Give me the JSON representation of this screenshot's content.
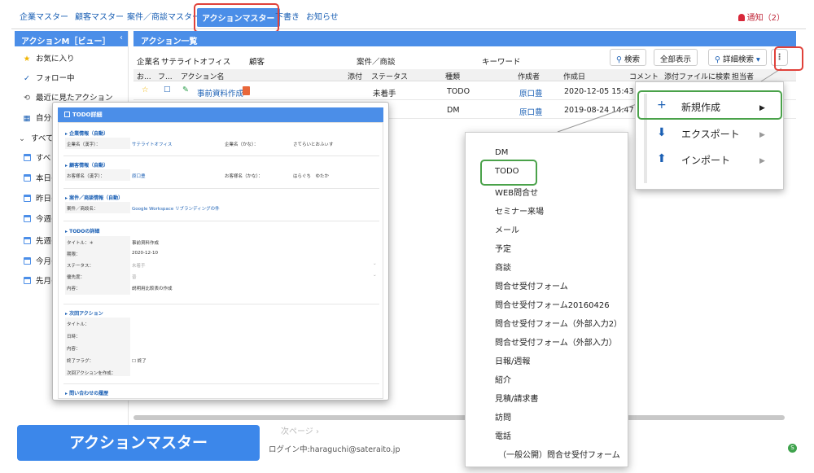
{
  "nav": {
    "tabs": [
      "企業マスター",
      "顧客マスター",
      "案件／商談マスター",
      "アクションマスター",
      "下書き",
      "お知らせ"
    ],
    "active_index": 3,
    "notice": "通知（2）"
  },
  "sidebar": {
    "title": "アクションM［ビュー］",
    "collapse": "‹",
    "items": [
      {
        "label": "お気に入り",
        "icon": "star-icon"
      },
      {
        "label": "フォロー中",
        "icon": "check-icon"
      },
      {
        "label": "最近に見たアクション",
        "icon": "history-icon"
      },
      {
        "label": "自分の",
        "icon": "grid-icon"
      },
      {
        "label": "すべての",
        "icon": "chevron-down-icon"
      },
      {
        "label": "すべ",
        "icon": "calendar-icon"
      },
      {
        "label": "本日の",
        "icon": "calendar-icon"
      },
      {
        "label": "昨日の",
        "icon": "calendar-icon"
      },
      {
        "label": "今週の",
        "icon": "calendar-icon"
      },
      {
        "label": "先週の",
        "icon": "calendar-icon"
      },
      {
        "label": "今月の",
        "icon": "calendar-icon"
      },
      {
        "label": "先月の",
        "icon": "calendar-icon"
      }
    ]
  },
  "main": {
    "title": "アクション一覧",
    "filters": {
      "company_label": "企業名",
      "company_value": "サテライトオフィス",
      "customer_label": "顧客",
      "deal_label": "案件／商談",
      "keyword_label": "キーワード"
    },
    "buttons": {
      "search": "検索",
      "show_all": "全部表示",
      "advanced": "詳細検索"
    },
    "columns": [
      "お...",
      "フ...",
      "アクション名",
      "添付",
      "ステータス",
      "種類",
      "作成者",
      "作成日",
      "コメント",
      "添付ファイルに検索",
      "担当者"
    ],
    "rows": [
      {
        "name": "事前資料作成",
        "status": "未着手",
        "type": "TODO",
        "creator": "原口豊",
        "date": "2020-12-05 15:43"
      },
      {
        "name": "",
        "status": "",
        "type": "DM",
        "creator": "原口豊",
        "date": "2019-08-24 14:47"
      }
    ],
    "pager_next": "次ページ ›",
    "footer": "ログイン中:haraguchi@sateraito.jp"
  },
  "todo_detail": {
    "title": "TODO詳細",
    "sections": {
      "company": "企業情報（自動）",
      "customer": "顧客情報（自動）",
      "deal": "案件／商談情報（自動）",
      "todo": "TODOの詳細",
      "next": "次回アクション",
      "inquiry": "問い合わせの履歴"
    },
    "fields": {
      "company_name_label": "企業名（漢字）：",
      "company_name_value": "サテライトオフィス",
      "company_kana_label": "企業名（かな）：",
      "company_kana_value": "さてらいとおふぃす",
      "customer_name_label": "お客様名（漢字）：",
      "customer_name_value": "原口豊",
      "customer_kana_label": "お客様名（かな）：",
      "customer_kana_value": "はらぐち　ゆたか",
      "deal_label": "案件／商談名：",
      "deal_value": "Google Workspace リブランディングの件",
      "title_label": "タイトル：＊",
      "title_value": "事前資料作成",
      "due_label": "期限：",
      "due_value": "2020-12-10",
      "status_label": "ステータス：",
      "status_value": "未着手",
      "priority_label": "優先度：",
      "priority_value": "普",
      "content_label": "内容：",
      "content_value": "説明用比較表の作成",
      "next_title_label": "タイトル：",
      "next_date_label": "日時：",
      "next_content_label": "内容：",
      "done_flag_label": "終了フラグ：",
      "done_flag_value": "終了",
      "create_next_label": "次回アクションを作成："
    }
  },
  "kebab_menu": {
    "items": [
      {
        "label": "新規作成",
        "icon": "plus-icon"
      },
      {
        "label": "エクスポート",
        "icon": "download-icon"
      },
      {
        "label": "インポート",
        "icon": "upload-icon"
      }
    ]
  },
  "type_menu": {
    "items": [
      "DM",
      "TODO",
      "WEB問合せ",
      "セミナー来場",
      "メール",
      "予定",
      "商談",
      "問合せ受付フォーム",
      "問合せ受付フォーム20160426",
      "問合せ受付フォーム（外部入力2）",
      "問合せ受付フォーム（外部入力）",
      "日報/週報",
      "紹介",
      "見積/請求書",
      "訪問",
      "電話",
      "（一般公開）問合せ受付フォーム"
    ]
  },
  "caption": "アクションマスター",
  "colors": {
    "primary": "#4b8ee8",
    "red": "#e0413a",
    "green": "#4aa24a",
    "link": "#1a5fb4"
  }
}
